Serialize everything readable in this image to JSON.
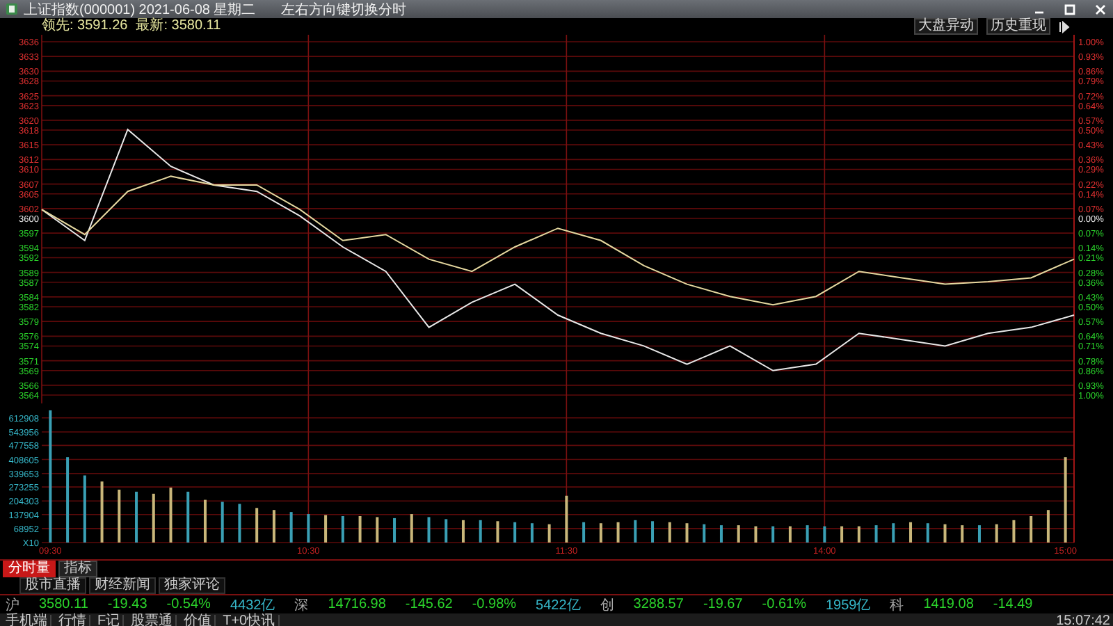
{
  "window": {
    "title": "上证指数(000001) 2021-06-08 星期二",
    "hint": "左右方向键切换分时"
  },
  "info": {
    "items": [
      "领先: 3591.26",
      "最新: 3580.11"
    ],
    "buttons": [
      "大盘异动",
      "历史重现"
    ]
  },
  "price_chart": {
    "percent_labels": [
      "1.00%",
      "0.93%",
      "0.86%",
      "0.79%",
      "0.72%",
      "0.64%",
      "0.57%",
      "0.50%",
      "0.43%",
      "0.36%",
      "0.29%",
      "0.22%",
      "0.14%",
      "0.07%",
      "0.00%",
      "0.07%",
      "0.14%",
      "0.21%",
      "0.28%",
      "0.36%",
      "0.43%",
      "0.50%",
      "0.57%",
      "0.64%",
      "0.71%",
      "0.78%",
      "0.86%",
      "0.93%",
      "1.00%"
    ],
    "chart_data": {
      "type": "line",
      "grid": true,
      "categories": [
        null,
        null,
        null,
        null,
        null,
        null,
        null,
        null,
        null,
        null,
        null,
        null,
        null,
        null,
        null,
        null,
        null,
        null,
        null,
        null,
        null,
        null,
        null,
        null,
        null
      ],
      "ylim": [
        3564,
        3636
      ],
      "yticks": [
        3636,
        3633,
        3630,
        3628,
        3625,
        3623,
        3620,
        3618,
        3615,
        3612,
        3610,
        3607,
        3605,
        3602,
        3600,
        3597,
        3594,
        3592,
        3589,
        3587,
        3584,
        3582,
        3579,
        3576,
        3574,
        3571,
        3569,
        3566,
        3564
      ],
      "series": [
        {
          "color": "#e8e8e8",
          "values": [
            3601.8,
            3595.5,
            3618.1,
            3610.6,
            3606.8,
            3605.5,
            3600.5,
            3594.2,
            3589.2,
            3577.8,
            3582.9,
            3586.6,
            3580.3,
            3576.6,
            3574.0,
            3570.3,
            3574.0,
            3569.0,
            3570.3,
            3576.6,
            3575.3,
            3574.0,
            3576.6,
            3577.8,
            3580.3
          ]
        },
        {
          "color": "#e6d9a0",
          "values": [
            3601.8,
            3596.7,
            3605.5,
            3608.6,
            3606.8,
            3606.8,
            3601.8,
            3595.5,
            3596.7,
            3591.7,
            3589.2,
            3594.2,
            3598.0,
            3595.5,
            3590.4,
            3586.6,
            3584.1,
            3582.4,
            3584.1,
            3589.2,
            3587.9,
            3586.6,
            3587.1,
            3587.9,
            3591.7
          ]
        }
      ]
    }
  },
  "volume_chart": {
    "chart_data": {
      "type": "bar",
      "grid": true,
      "ylim": [
        0,
        684000
      ],
      "categories": [
        "09:30",
        null,
        null,
        null,
        null,
        null,
        null,
        null,
        null,
        null,
        null,
        null,
        null,
        null,
        null,
        "10:30",
        null,
        null,
        null,
        null,
        null,
        null,
        null,
        null,
        null,
        null,
        null,
        null,
        null,
        null,
        "11:30",
        null,
        null,
        null,
        null,
        null,
        null,
        null,
        null,
        null,
        null,
        null,
        null,
        null,
        null,
        "14:00",
        null,
        null,
        null,
        null,
        null,
        null,
        null,
        null,
        null,
        null,
        null,
        null,
        null,
        "15:00"
      ],
      "yticks": [
        {
          "value": 612908,
          "label": "612908"
        },
        {
          "value": 543956,
          "label": "543956"
        },
        {
          "value": 477558,
          "label": "477558"
        },
        {
          "value": 408605,
          "label": "408605"
        },
        {
          "value": 339653,
          "label": "339653"
        },
        {
          "value": 273255,
          "label": "273255"
        },
        {
          "value": 204303,
          "label": "204303"
        },
        {
          "value": 137904,
          "label": "137904"
        },
        {
          "value": 68952,
          "label": "68952"
        },
        {
          "value": 0,
          "label": "X10"
        }
      ],
      "series": [
        {
          "color": "#c9b77a",
          "values": [
            null,
            null,
            null,
            300000,
            260000,
            null,
            240000,
            270000,
            null,
            210000,
            null,
            null,
            170000,
            160000,
            null,
            null,
            135000,
            null,
            130000,
            125000,
            null,
            140000,
            null,
            null,
            110000,
            null,
            105000,
            null,
            null,
            90000,
            230000,
            null,
            95000,
            100000,
            null,
            null,
            100000,
            95000,
            null,
            null,
            85000,
            80000,
            null,
            80000,
            null,
            null,
            80000,
            80000,
            null,
            null,
            100000,
            null,
            90000,
            85000,
            null,
            90000,
            110000,
            130000,
            160000,
            420000
          ]
        },
        {
          "color": "#3aa0b5",
          "values": [
            650000,
            420000,
            330000,
            null,
            null,
            250000,
            null,
            null,
            250000,
            null,
            200000,
            190000,
            null,
            null,
            150000,
            140000,
            null,
            130000,
            null,
            null,
            120000,
            null,
            125000,
            115000,
            null,
            110000,
            null,
            100000,
            95000,
            null,
            null,
            100000,
            null,
            null,
            110000,
            105000,
            null,
            null,
            90000,
            85000,
            null,
            null,
            80000,
            null,
            85000,
            80000,
            null,
            null,
            85000,
            95000,
            null,
            95000,
            null,
            null,
            85000,
            null,
            null,
            null,
            null,
            null
          ]
        }
      ]
    }
  },
  "tabs": [
    {
      "label": "分时量",
      "selected": true
    },
    {
      "label": "指标",
      "selected": false
    }
  ],
  "news_tabs": [
    "股市直播",
    "财经新闻",
    "独家评论"
  ],
  "quotes": [
    {
      "market": "沪",
      "last": "3580.11",
      "change": "-19.43",
      "pct": "-0.54%",
      "amount": "4432亿"
    },
    {
      "market": "深",
      "last": "14716.98",
      "change": "-145.62",
      "pct": "-0.98%",
      "amount": "5422亿"
    },
    {
      "market": "创",
      "last": "3288.57",
      "change": "-19.67",
      "pct": "-0.61%",
      "amount": "1959亿"
    },
    {
      "market": "科",
      "last": "1419.08",
      "change": "-14.49"
    }
  ],
  "status_bar": {
    "items": [
      "手机端",
      "行情",
      "F记",
      "股票通",
      "价值",
      "T+0快讯"
    ],
    "time": "15:07:42"
  }
}
